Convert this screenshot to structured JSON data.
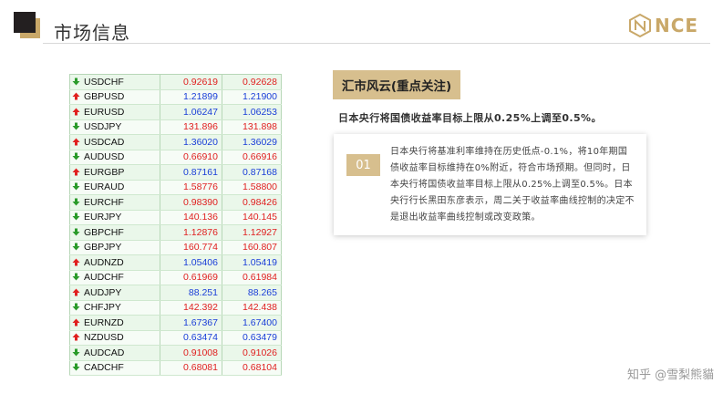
{
  "header": {
    "title": "市场信息",
    "logo_text": "NCE"
  },
  "colors": {
    "accent": "#d7bf8e",
    "up": "#1a3ed8",
    "down": "#e02020",
    "row": "#eaf7ea"
  },
  "quotes": [
    {
      "symbol": "USDCHF",
      "bid": "0.92619",
      "ask": "0.92628",
      "dir": "down"
    },
    {
      "symbol": "GBPUSD",
      "bid": "1.21899",
      "ask": "1.21900",
      "dir": "up"
    },
    {
      "symbol": "EURUSD",
      "bid": "1.06247",
      "ask": "1.06253",
      "dir": "up"
    },
    {
      "symbol": "USDJPY",
      "bid": "131.896",
      "ask": "131.898",
      "dir": "down"
    },
    {
      "symbol": "USDCAD",
      "bid": "1.36020",
      "ask": "1.36029",
      "dir": "up"
    },
    {
      "symbol": "AUDUSD",
      "bid": "0.66910",
      "ask": "0.66916",
      "dir": "down"
    },
    {
      "symbol": "EURGBP",
      "bid": "0.87161",
      "ask": "0.87168",
      "dir": "up"
    },
    {
      "symbol": "EURAUD",
      "bid": "1.58776",
      "ask": "1.58800",
      "dir": "down"
    },
    {
      "symbol": "EURCHF",
      "bid": "0.98390",
      "ask": "0.98426",
      "dir": "down"
    },
    {
      "symbol": "EURJPY",
      "bid": "140.136",
      "ask": "140.145",
      "dir": "down"
    },
    {
      "symbol": "GBPCHF",
      "bid": "1.12876",
      "ask": "1.12927",
      "dir": "down"
    },
    {
      "symbol": "GBPJPY",
      "bid": "160.774",
      "ask": "160.807",
      "dir": "down"
    },
    {
      "symbol": "AUDNZD",
      "bid": "1.05406",
      "ask": "1.05419",
      "dir": "up"
    },
    {
      "symbol": "AUDCHF",
      "bid": "0.61969",
      "ask": "0.61984",
      "dir": "down"
    },
    {
      "symbol": "AUDJPY",
      "bid": "88.251",
      "ask": "88.265",
      "dir": "up"
    },
    {
      "symbol": "CHFJPY",
      "bid": "142.392",
      "ask": "142.438",
      "dir": "down"
    },
    {
      "symbol": "EURNZD",
      "bid": "1.67367",
      "ask": "1.67400",
      "dir": "up"
    },
    {
      "symbol": "NZDUSD",
      "bid": "0.63474",
      "ask": "0.63479",
      "dir": "up"
    },
    {
      "symbol": "AUDCAD",
      "bid": "0.91008",
      "ask": "0.91026",
      "dir": "down"
    },
    {
      "symbol": "CADCHF",
      "bid": "0.68081",
      "ask": "0.68104",
      "dir": "down"
    }
  ],
  "news": {
    "tag": "汇市风云(重点关注)",
    "headline": "日本央行将国债收益率目标上限从0.25%上调至0.5%。",
    "number": "01",
    "body": "日本央行将基准利率维持在历史低点-0.1%，将10年期国债收益率目标维持在0%附近，符合市场预期。但同时，日本央行将国债收益率目标上限从0.25%上调至0.5%。日本央行行长黑田东彦表示，周二关于收益率曲线控制的决定不是退出收益率曲线控制或改变政策。"
  },
  "watermark": "知乎 @雪梨熊貓"
}
